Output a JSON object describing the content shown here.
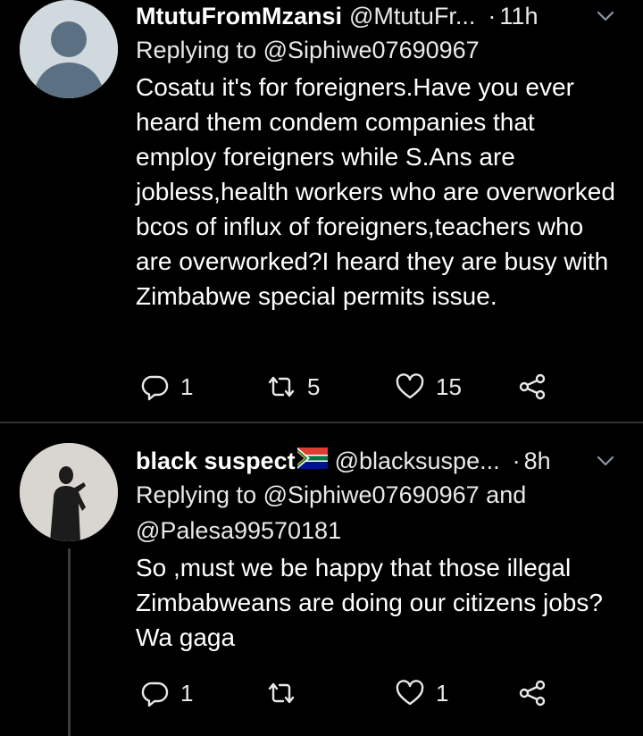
{
  "tweets": [
    {
      "display_name": "MtutuFromMzansi",
      "handle": "@MtutuFr...",
      "dot": "·",
      "time": "11h",
      "replying_to": "Replying to @Siphiwe07690967",
      "text": "Cosatu it's for foreigners.Have you ever heard them condem companies that employ foreigners while S.Ans are jobless,health workers who are overworked bcos of influx of foreigners,teachers who are overworked?I heard they are busy with Zimbabwe special permits issue.",
      "replies": "1",
      "retweets": "5",
      "likes": "15"
    },
    {
      "display_name": "black suspect",
      "name_flag": "south-africa-flag",
      "handle": "@blacksuspe...",
      "dot": "·",
      "time": "8h",
      "replying_to": "Replying to @Siphiwe07690967 and @Palesa99570181",
      "text": "So ,must we be happy that those illegal Zimbabweans are doing our citizens jobs? Wa gaga",
      "replies": "1",
      "retweets": "",
      "likes": "1"
    }
  ],
  "icons": {
    "reply": "reply-icon",
    "retweet": "retweet-icon",
    "like": "heart-icon",
    "share": "share-icon",
    "more": "chevron-down-icon"
  },
  "colors": {
    "background": "#000000",
    "text": "#ffffff",
    "secondary": "#e7e9ea",
    "divider": "#2f3336"
  }
}
